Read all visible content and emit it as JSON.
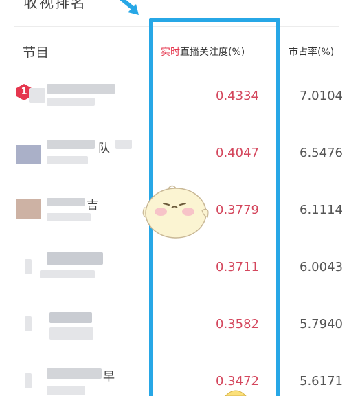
{
  "section_title": "收视排名",
  "header": {
    "program": "节目",
    "attention_accent": "实时",
    "attention_rest": "直播关注度(%)",
    "share": "市占率(%)"
  },
  "rows": [
    {
      "rank": "1",
      "attention": "0.4334",
      "share": "7.0104",
      "name_fragment": ""
    },
    {
      "rank": "",
      "attention": "0.4047",
      "share": "6.5476",
      "name_fragment": "队"
    },
    {
      "rank": "",
      "attention": "0.3779",
      "share": "6.1114",
      "name_fragment": "吉"
    },
    {
      "rank": "",
      "attention": "0.3711",
      "share": "6.0043",
      "name_fragment": ""
    },
    {
      "rank": "",
      "attention": "0.3582",
      "share": "5.7940",
      "name_fragment": ""
    },
    {
      "rank": "",
      "attention": "0.3472",
      "share": "5.6171",
      "name_fragment": "早"
    }
  ],
  "colors": {
    "accent_red": "#e5364e",
    "value_red": "#d4475d",
    "highlight_blue": "#27a7e6"
  },
  "icons": [
    "arrow-pointer-icon",
    "mascot-sticker-icon",
    "rank-1-badge-icon"
  ]
}
